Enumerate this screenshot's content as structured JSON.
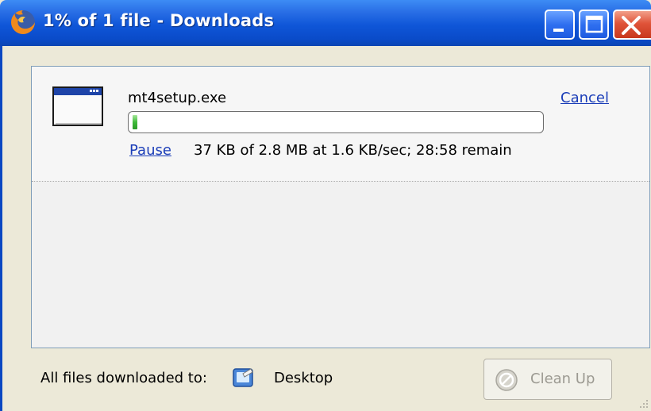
{
  "window": {
    "title": "1% of 1 file - Downloads",
    "app_icon": "firefox-icon",
    "controls": [
      "minimize",
      "maximize",
      "close"
    ]
  },
  "downloads": [
    {
      "file_name": "mt4setup.exe",
      "file_icon": "application-window-icon",
      "cancel_label": "Cancel",
      "pause_label": "Pause",
      "status": "37 KB of 2.8 MB at 1.6 KB/sec; 28:58 remain",
      "progress_percent": 1
    }
  ],
  "footer": {
    "label": "All files downloaded to:",
    "folder_icon": "desktop-folder-icon",
    "folder_name": "Desktop",
    "cleanup_label": "Clean Up",
    "cleanup_enabled": false
  },
  "colors": {
    "titlebar": "#0f56d8",
    "link": "#1a3db8",
    "progress_fill": "#3fba3a",
    "close_button": "#e0543a"
  }
}
